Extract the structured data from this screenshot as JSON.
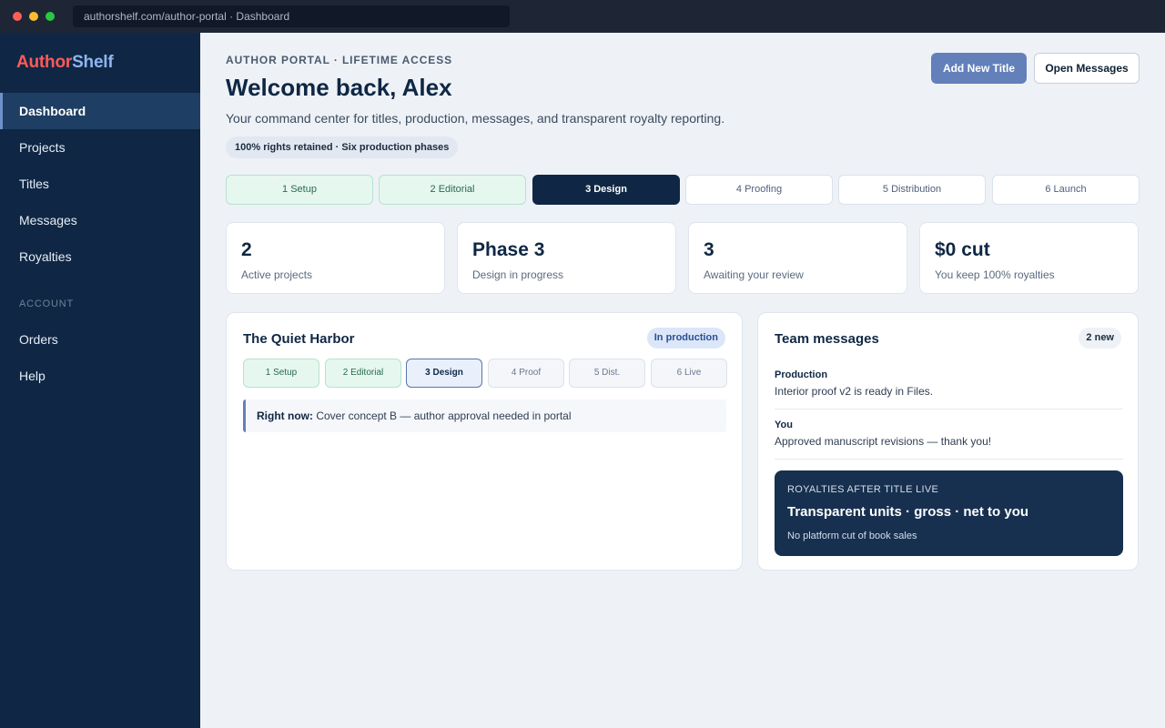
{
  "browser": {
    "url": "authorshelf.com/author-portal · Dashboard"
  },
  "brand": {
    "part1": "Author",
    "part2": "Shelf"
  },
  "sidebar": {
    "items": [
      {
        "label": "Dashboard",
        "active": true
      },
      {
        "label": "Projects"
      },
      {
        "label": "Titles"
      },
      {
        "label": "Messages"
      },
      {
        "label": "Royalties"
      }
    ],
    "section_label": "ACCOUNT",
    "account_items": [
      {
        "label": "Orders"
      },
      {
        "label": "Help"
      }
    ]
  },
  "header": {
    "eyebrow": "AUTHOR PORTAL · LIFETIME ACCESS",
    "title": "Welcome back, Alex",
    "subtitle": "Your command center for titles, production, messages, and transparent royalty reporting.",
    "pill": "100% rights retained · Six production phases",
    "primary_button": "Add New Title",
    "secondary_button": "Open Messages"
  },
  "phases": [
    {
      "label": "1 Setup",
      "state": "done"
    },
    {
      "label": "2 Editorial",
      "state": "done"
    },
    {
      "label": "3 Design",
      "state": "current"
    },
    {
      "label": "4 Proofing",
      "state": "todo"
    },
    {
      "label": "5 Distribution",
      "state": "todo"
    },
    {
      "label": "6 Launch",
      "state": "todo"
    }
  ],
  "stats": [
    {
      "value": "2",
      "label": "Active projects"
    },
    {
      "value": "Phase 3",
      "label": "Design in progress"
    },
    {
      "value": "3",
      "label": "Awaiting your review"
    },
    {
      "value": "$0 cut",
      "label": "You keep 100% royalties"
    }
  ],
  "project": {
    "title": "The Quiet Harbor",
    "badge": "In production",
    "mini_phases": [
      {
        "label": "1 Setup",
        "state": "done"
      },
      {
        "label": "2 Editorial",
        "state": "done"
      },
      {
        "label": "3 Design",
        "state": "current"
      },
      {
        "label": "4 Proof",
        "state": "todo"
      },
      {
        "label": "5 Dist.",
        "state": "todo"
      },
      {
        "label": "6 Live",
        "state": "todo"
      }
    ],
    "right_now_label": "Right now:",
    "right_now_text": "Cover concept B — author approval needed in portal"
  },
  "messages": {
    "title": "Team messages",
    "badge": "2 new",
    "items": [
      {
        "from": "Production",
        "text": "Interior proof v2 is ready in Files."
      },
      {
        "from": "You",
        "text": "Approved manuscript revisions — thank you!"
      }
    ]
  },
  "royalty": {
    "eyebrow": "ROYALTIES AFTER TITLE LIVE",
    "headline": "Transparent units · gross · net to you",
    "sub": "No platform cut of book sales"
  }
}
